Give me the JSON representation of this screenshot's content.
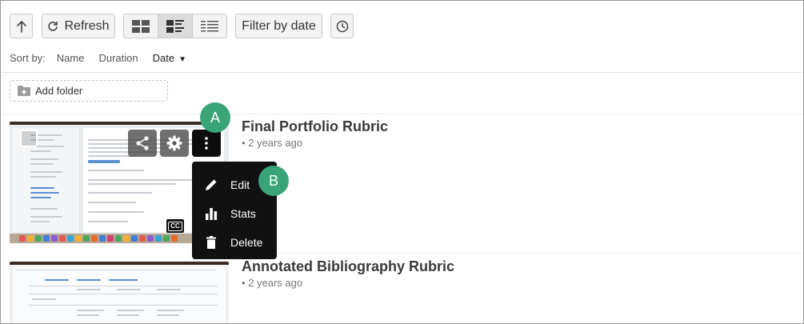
{
  "toolbar": {
    "up_icon": "arrow-up-icon",
    "refresh_label": "Refresh",
    "refresh_icon": "refresh-icon",
    "views": [
      {
        "icon": "grid-view-icon",
        "active": false
      },
      {
        "icon": "detailed-list-view-icon",
        "active": true
      },
      {
        "icon": "compact-list-view-icon",
        "active": false
      }
    ],
    "filter_label": "Filter by date",
    "clock_icon": "clock-icon"
  },
  "sort": {
    "label": "Sort by:",
    "options": [
      "Name",
      "Duration",
      "Date"
    ],
    "active": "Date"
  },
  "add_folder_label": "Add folder",
  "media": [
    {
      "title": "Final Portfolio Rubric",
      "age": "2 years ago"
    },
    {
      "title": "Annotated Bibliography Rubric",
      "age": "2 years ago"
    }
  ],
  "thumbnail_overlay": {
    "cc_label": "CC"
  },
  "context_menu": {
    "items": [
      {
        "label": "Edit",
        "icon": "pencil-icon"
      },
      {
        "label": "Stats",
        "icon": "bar-chart-icon"
      },
      {
        "label": "Delete",
        "icon": "trash-icon"
      }
    ]
  },
  "callouts": [
    "A",
    "B"
  ],
  "colors": {
    "callout": "#3aa479",
    "menu_bg": "#111111"
  }
}
